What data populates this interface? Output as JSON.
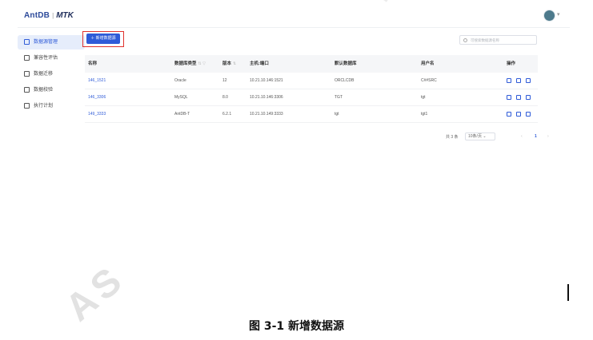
{
  "header": {
    "brand": "AntDB",
    "separator": "|",
    "product": "MTK"
  },
  "sidebar": {
    "items": [
      {
        "label": "数据源管理",
        "active": true
      },
      {
        "label": "兼容性评估",
        "active": false
      },
      {
        "label": "数据迁移",
        "active": false
      },
      {
        "label": "数据校验",
        "active": false
      },
      {
        "label": "执行计划",
        "active": false
      }
    ]
  },
  "toolbar": {
    "add_label": "＋ 新增数据源",
    "search_placeholder": "可搜索数据源名称"
  },
  "table": {
    "columns": [
      "名称",
      "数据库类型",
      "版本",
      "主机:端口",
      "默认数据库",
      "用户名",
      "操作"
    ],
    "rows": [
      {
        "name": "146_1521",
        "type": "Oracle",
        "version": "12",
        "host": "10.21.10.146:1521",
        "db": "ORCLCDB",
        "user": "C##SRC"
      },
      {
        "name": "146_3306",
        "type": "MySQL",
        "version": "8.0",
        "host": "10.21.10.146:3306",
        "db": "TGT",
        "user": "tgt"
      },
      {
        "name": "149_3333",
        "type": "AntDB-T",
        "version": "6.2.1",
        "host": "10.21.10.149:3333",
        "db": "tgt",
        "user": "tgt1"
      }
    ]
  },
  "pagination": {
    "total": "共 3 条",
    "page_size": "10条/页",
    "current": "1",
    "prev": "‹",
    "next": "›"
  },
  "caption": "图 3-1  新增数据源",
  "colors": {
    "accent": "#2f5bd8",
    "highlight": "#e0322d"
  }
}
